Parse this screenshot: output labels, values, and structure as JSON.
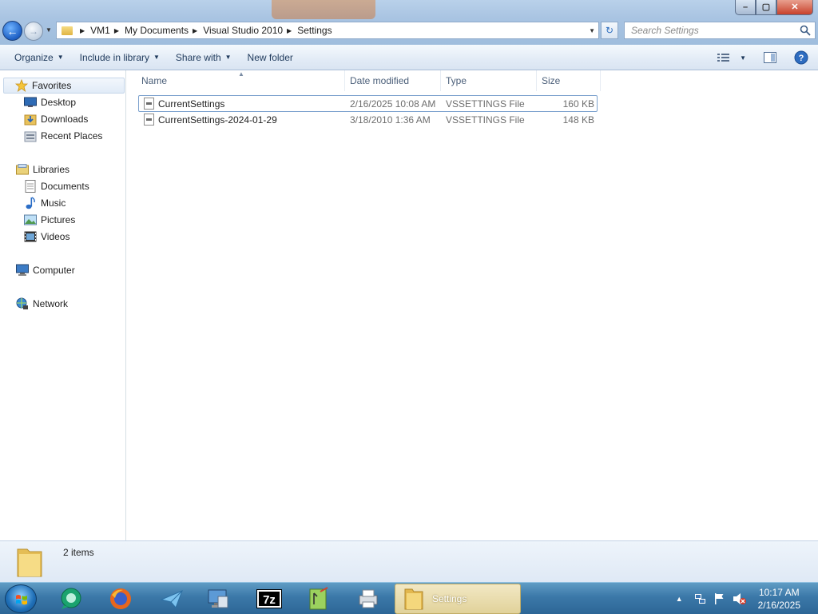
{
  "window": {
    "controls": {
      "minimize": "–",
      "maximize": "▢",
      "close": "✕"
    }
  },
  "address_bar": {
    "segments": [
      "VM1",
      "My Documents",
      "Visual Studio 2010",
      "Settings"
    ]
  },
  "search": {
    "placeholder": "Search Settings"
  },
  "toolbar": {
    "organize": "Organize",
    "include_in_library": "Include in library",
    "share_with": "Share with",
    "new_folder": "New folder"
  },
  "nav_pane": {
    "favorites": "Favorites",
    "favorites_items": [
      "Desktop",
      "Downloads",
      "Recent Places"
    ],
    "libraries": "Libraries",
    "libraries_items": [
      "Documents",
      "Music",
      "Pictures",
      "Videos"
    ],
    "computer": "Computer",
    "network": "Network"
  },
  "columns": [
    "Name",
    "Date modified",
    "Type",
    "Size"
  ],
  "files": [
    {
      "name": "CurrentSettings",
      "date": "2/16/2025 10:08 AM",
      "type": "VSSETTINGS File",
      "size": "160 KB",
      "selected": true
    },
    {
      "name": "CurrentSettings-2024-01-29",
      "date": "3/18/2010 1:36 AM",
      "type": "VSSETTINGS File",
      "size": "148 KB",
      "selected": false
    }
  ],
  "details": {
    "item_count": "2 items"
  },
  "taskbar": {
    "active_window": "Settings",
    "pinned_icons": [
      "chat-icon",
      "firefox-icon",
      "send-icon",
      "remote-desktop-icon",
      "7zip-icon",
      "notepadpp-icon",
      "printer-icon"
    ],
    "clock_time": "10:17 AM",
    "clock_date": "2/16/2025"
  },
  "colors": {
    "accent": "#3b78a8",
    "selection_border": "#7da2ce",
    "toolbar_text": "#1e395b"
  }
}
